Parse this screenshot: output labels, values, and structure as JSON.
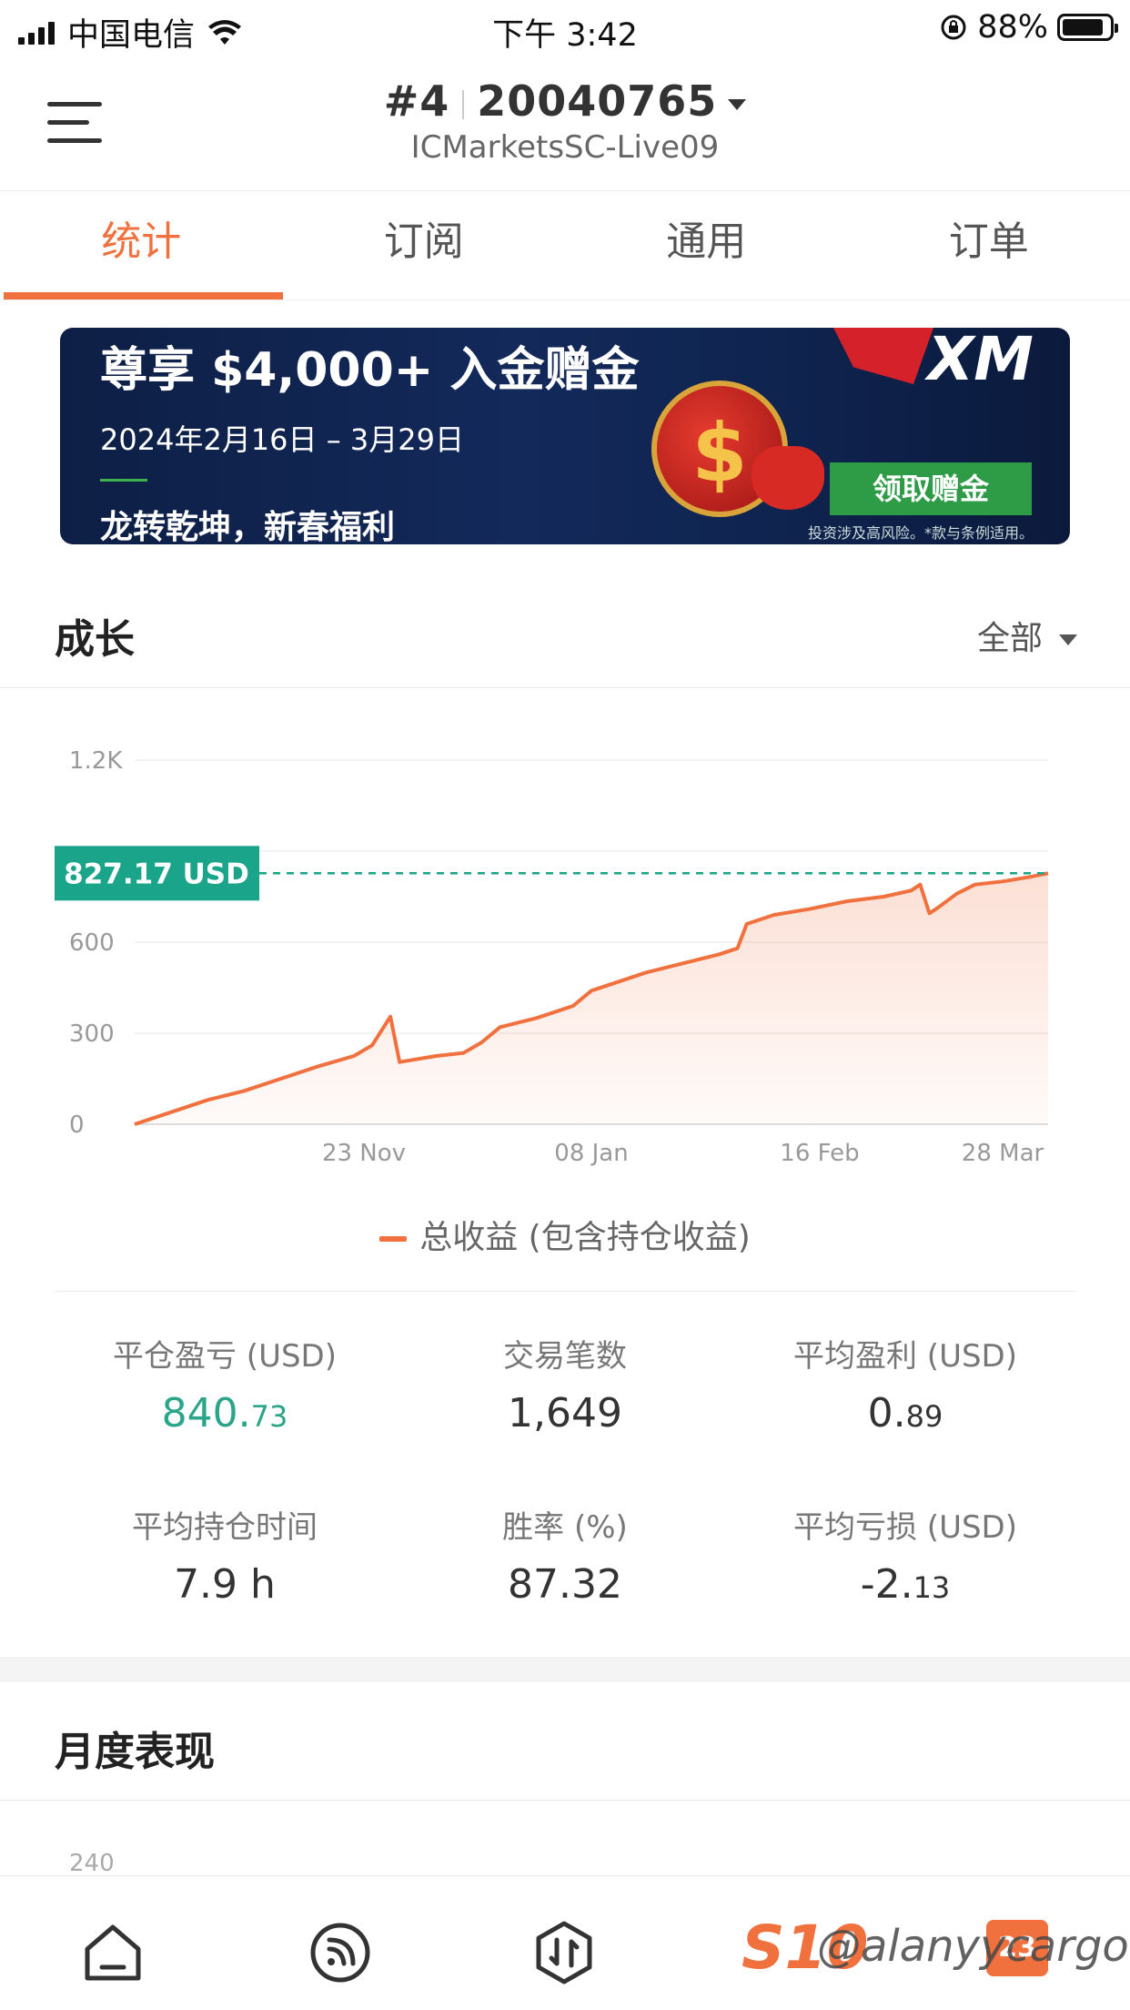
{
  "status_bar": {
    "carrier": "中国电信",
    "time": "下午 3:42",
    "battery": "88%"
  },
  "header": {
    "account_number": "#4",
    "account_id": "20040765",
    "server": "ICMarketsSC-Live09"
  },
  "tabs": [
    {
      "label": "统计",
      "active": true
    },
    {
      "label": "订阅",
      "active": false
    },
    {
      "label": "通用",
      "active": false
    },
    {
      "label": "订单",
      "active": false
    }
  ],
  "banner": {
    "title": "尊享 $4,000+ 入金赠金",
    "date_range": "2024年2月16日 – 3月29日",
    "slogan": "龙转乾坤，新春福利",
    "logo": "XM",
    "button_label": "领取赠金",
    "disclaimer": "投资涉及高风险。*款与条例适用。"
  },
  "growth": {
    "title": "成长",
    "filter": "全部",
    "current_value_label": "827.17 USD",
    "legend": "总收益 (包含持仓收益)"
  },
  "chart_data": {
    "type": "area",
    "y_ticks": [
      "0",
      "300",
      "600",
      "1.2K"
    ],
    "x_ticks": [
      "23 Nov",
      "08 Jan",
      "16 Feb",
      "28 Mar"
    ],
    "ylim": [
      0,
      1200
    ],
    "grid": true,
    "current_value": 827.17,
    "line_color": "#f0703e",
    "marker_color": "#1aa58a",
    "series": [
      {
        "name": "总收益 (包含持仓收益)",
        "points": [
          [
            0,
            0
          ],
          [
            4,
            40
          ],
          [
            8,
            80
          ],
          [
            12,
            110
          ],
          [
            16,
            150
          ],
          [
            20,
            190
          ],
          [
            24,
            225
          ],
          [
            26,
            260
          ],
          [
            28,
            355
          ],
          [
            29,
            205
          ],
          [
            33,
            225
          ],
          [
            36,
            235
          ],
          [
            38,
            270
          ],
          [
            40,
            320
          ],
          [
            44,
            350
          ],
          [
            48,
            390
          ],
          [
            50,
            440
          ],
          [
            53,
            470
          ],
          [
            56,
            500
          ],
          [
            60,
            530
          ],
          [
            64,
            560
          ],
          [
            66,
            580
          ],
          [
            67,
            660
          ],
          [
            70,
            690
          ],
          [
            74,
            710
          ],
          [
            78,
            735
          ],
          [
            82,
            750
          ],
          [
            85,
            770
          ],
          [
            86,
            790
          ],
          [
            87,
            695
          ],
          [
            88,
            715
          ],
          [
            90,
            760
          ],
          [
            92,
            790
          ],
          [
            95,
            800
          ],
          [
            98,
            815
          ],
          [
            100,
            827.17
          ]
        ]
      }
    ]
  },
  "stats": [
    {
      "label": "平仓盈亏 (USD)",
      "int": "840.",
      "dec": "73",
      "color": "#2aa58a"
    },
    {
      "label": "交易笔数",
      "int": "1,649",
      "dec": ""
    },
    {
      "label": "平均盈利 (USD)",
      "int": "0.",
      "dec": "89"
    },
    {
      "label": "平均持仓时间",
      "int": "7.9 h",
      "dec": ""
    },
    {
      "label": "胜率 (%)",
      "int": "87.32",
      "dec": ""
    },
    {
      "label": "平均亏损 (USD)",
      "int": "-2.",
      "dec": "13"
    }
  ],
  "monthly": {
    "title": "月度表现",
    "first_tick": "240"
  },
  "bottom_nav": [
    {
      "icon": "home-icon"
    },
    {
      "icon": "feed-icon"
    },
    {
      "icon": "trade-icon"
    },
    {
      "icon": "s10-logo",
      "label": "S10"
    },
    {
      "icon": "badge-icon",
      "label": "23"
    }
  ],
  "watermark": "@alanyycargo"
}
